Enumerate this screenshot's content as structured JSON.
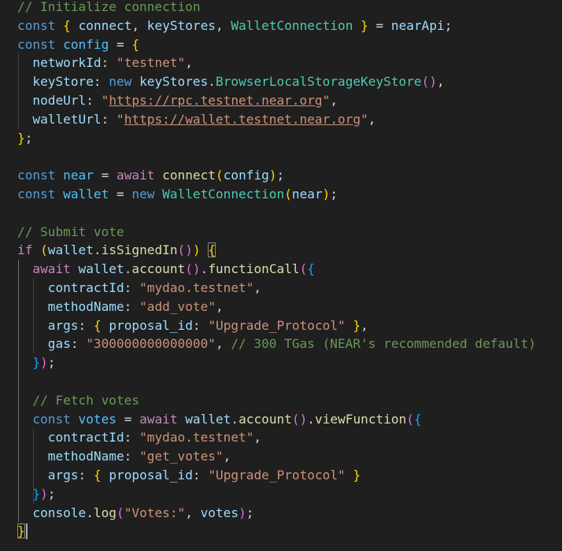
{
  "editor": {
    "language": "javascript",
    "theme_colors": {
      "background": "#1f1f1f",
      "keyword": "#569cd6",
      "control_keyword": "#c586c0",
      "variable": "#9cdcfe",
      "constant": "#4fc1ff",
      "class": "#4ec9b0",
      "function": "#dcdcaa",
      "string": "#ce9178",
      "comment": "#6a9955",
      "bracket_level_1": "#ffd700",
      "bracket_level_2": "#da70d6",
      "bracket_level_3": "#179fff"
    },
    "lines": [
      {
        "tokens": [
          {
            "t": "// Initialize connection",
            "c": "cm"
          }
        ]
      },
      {
        "tokens": [
          {
            "t": "const",
            "c": "kw"
          },
          {
            "t": " ",
            "c": "p"
          },
          {
            "t": "{",
            "c": "b1"
          },
          {
            "t": " ",
            "c": "p"
          },
          {
            "t": "connect",
            "c": "var"
          },
          {
            "t": ", ",
            "c": "p"
          },
          {
            "t": "keyStores",
            "c": "var"
          },
          {
            "t": ", ",
            "c": "p"
          },
          {
            "t": "WalletConnection",
            "c": "cls"
          },
          {
            "t": " ",
            "c": "p"
          },
          {
            "t": "}",
            "c": "b1"
          },
          {
            "t": " = ",
            "c": "p"
          },
          {
            "t": "nearApi",
            "c": "var"
          },
          {
            "t": ";",
            "c": "p"
          }
        ]
      },
      {
        "tokens": [
          {
            "t": "const",
            "c": "kw"
          },
          {
            "t": " ",
            "c": "p"
          },
          {
            "t": "config",
            "c": "const"
          },
          {
            "t": " = ",
            "c": "p"
          },
          {
            "t": "{",
            "c": "b1"
          }
        ]
      },
      {
        "tokens": [
          {
            "t": "  ",
            "c": "p"
          },
          {
            "t": "networkId",
            "c": "var"
          },
          {
            "t": ": ",
            "c": "p"
          },
          {
            "t": "\"testnet\"",
            "c": "str"
          },
          {
            "t": ",",
            "c": "p"
          }
        ]
      },
      {
        "tokens": [
          {
            "t": "  ",
            "c": "p"
          },
          {
            "t": "keyStore",
            "c": "var"
          },
          {
            "t": ": ",
            "c": "p"
          },
          {
            "t": "new",
            "c": "kw"
          },
          {
            "t": " ",
            "c": "p"
          },
          {
            "t": "keyStores",
            "c": "var"
          },
          {
            "t": ".",
            "c": "p"
          },
          {
            "t": "BrowserLocalStorageKeyStore",
            "c": "cls"
          },
          {
            "t": "()",
            "c": "b2"
          },
          {
            "t": ",",
            "c": "p"
          }
        ]
      },
      {
        "tokens": [
          {
            "t": "  ",
            "c": "p"
          },
          {
            "t": "nodeUrl",
            "c": "var"
          },
          {
            "t": ": ",
            "c": "p"
          },
          {
            "t": "\"",
            "c": "str"
          },
          {
            "t": "https://rpc.testnet.near.org",
            "c": "url"
          },
          {
            "t": "\"",
            "c": "str"
          },
          {
            "t": ",",
            "c": "p"
          }
        ]
      },
      {
        "tokens": [
          {
            "t": "  ",
            "c": "p"
          },
          {
            "t": "walletUrl",
            "c": "var"
          },
          {
            "t": ": ",
            "c": "p"
          },
          {
            "t": "\"",
            "c": "str"
          },
          {
            "t": "https://wallet.testnet.near.org",
            "c": "url"
          },
          {
            "t": "\"",
            "c": "str"
          },
          {
            "t": ",",
            "c": "p"
          }
        ]
      },
      {
        "tokens": [
          {
            "t": "}",
            "c": "b1"
          },
          {
            "t": ";",
            "c": "p"
          }
        ]
      },
      {
        "tokens": []
      },
      {
        "tokens": [
          {
            "t": "const",
            "c": "kw"
          },
          {
            "t": " ",
            "c": "p"
          },
          {
            "t": "near",
            "c": "const"
          },
          {
            "t": " = ",
            "c": "p"
          },
          {
            "t": "await",
            "c": "ctl"
          },
          {
            "t": " ",
            "c": "p"
          },
          {
            "t": "connect",
            "c": "fn"
          },
          {
            "t": "(",
            "c": "b1"
          },
          {
            "t": "config",
            "c": "var"
          },
          {
            "t": ")",
            "c": "b1"
          },
          {
            "t": ";",
            "c": "p"
          }
        ]
      },
      {
        "tokens": [
          {
            "t": "const",
            "c": "kw"
          },
          {
            "t": " ",
            "c": "p"
          },
          {
            "t": "wallet",
            "c": "const"
          },
          {
            "t": " = ",
            "c": "p"
          },
          {
            "t": "new",
            "c": "kw"
          },
          {
            "t": " ",
            "c": "p"
          },
          {
            "t": "WalletConnection",
            "c": "cls"
          },
          {
            "t": "(",
            "c": "b1"
          },
          {
            "t": "near",
            "c": "var"
          },
          {
            "t": ")",
            "c": "b1"
          },
          {
            "t": ";",
            "c": "p"
          }
        ]
      },
      {
        "tokens": []
      },
      {
        "tokens": [
          {
            "t": "// Submit vote",
            "c": "cm"
          }
        ]
      },
      {
        "tokens": [
          {
            "t": "if",
            "c": "ctl"
          },
          {
            "t": " ",
            "c": "p"
          },
          {
            "t": "(",
            "c": "b1"
          },
          {
            "t": "wallet",
            "c": "var"
          },
          {
            "t": ".",
            "c": "p"
          },
          {
            "t": "isSignedIn",
            "c": "fn"
          },
          {
            "t": "()",
            "c": "b2"
          },
          {
            "t": ")",
            "c": "b1"
          },
          {
            "t": " ",
            "c": "p"
          },
          {
            "t": "{",
            "c": "b1",
            "m": true
          }
        ]
      },
      {
        "tokens": [
          {
            "t": "  ",
            "c": "p"
          },
          {
            "t": "await",
            "c": "ctl"
          },
          {
            "t": " ",
            "c": "p"
          },
          {
            "t": "wallet",
            "c": "var"
          },
          {
            "t": ".",
            "c": "p"
          },
          {
            "t": "account",
            "c": "fn"
          },
          {
            "t": "()",
            "c": "b2"
          },
          {
            "t": ".",
            "c": "p"
          },
          {
            "t": "functionCall",
            "c": "fn"
          },
          {
            "t": "(",
            "c": "b2"
          },
          {
            "t": "{",
            "c": "b3"
          }
        ]
      },
      {
        "tokens": [
          {
            "t": "    ",
            "c": "p"
          },
          {
            "t": "contractId",
            "c": "var"
          },
          {
            "t": ": ",
            "c": "p"
          },
          {
            "t": "\"mydao.testnet\"",
            "c": "str"
          },
          {
            "t": ",",
            "c": "p"
          }
        ]
      },
      {
        "tokens": [
          {
            "t": "    ",
            "c": "p"
          },
          {
            "t": "methodName",
            "c": "var"
          },
          {
            "t": ": ",
            "c": "p"
          },
          {
            "t": "\"add_vote\"",
            "c": "str"
          },
          {
            "t": ",",
            "c": "p"
          }
        ]
      },
      {
        "tokens": [
          {
            "t": "    ",
            "c": "p"
          },
          {
            "t": "args",
            "c": "var"
          },
          {
            "t": ": ",
            "c": "p"
          },
          {
            "t": "{",
            "c": "b1"
          },
          {
            "t": " ",
            "c": "p"
          },
          {
            "t": "proposal_id",
            "c": "var"
          },
          {
            "t": ": ",
            "c": "p"
          },
          {
            "t": "\"Upgrade_Protocol\"",
            "c": "str"
          },
          {
            "t": " ",
            "c": "p"
          },
          {
            "t": "}",
            "c": "b1"
          },
          {
            "t": ",",
            "c": "p"
          }
        ]
      },
      {
        "tokens": [
          {
            "t": "    ",
            "c": "p"
          },
          {
            "t": "gas",
            "c": "var"
          },
          {
            "t": ": ",
            "c": "p"
          },
          {
            "t": "\"300000000000000\"",
            "c": "str"
          },
          {
            "t": ", ",
            "c": "p"
          },
          {
            "t": "// 300 TGas (NEAR's recommended default)",
            "c": "cm"
          }
        ]
      },
      {
        "tokens": [
          {
            "t": "  ",
            "c": "p"
          },
          {
            "t": "}",
            "c": "b3"
          },
          {
            "t": ")",
            "c": "b2"
          },
          {
            "t": ";",
            "c": "p"
          }
        ]
      },
      {
        "tokens": []
      },
      {
        "tokens": [
          {
            "t": "  ",
            "c": "p"
          },
          {
            "t": "// Fetch votes",
            "c": "cm"
          }
        ]
      },
      {
        "tokens": [
          {
            "t": "  ",
            "c": "p"
          },
          {
            "t": "const",
            "c": "kw"
          },
          {
            "t": " ",
            "c": "p"
          },
          {
            "t": "votes",
            "c": "const"
          },
          {
            "t": " = ",
            "c": "p"
          },
          {
            "t": "await",
            "c": "ctl"
          },
          {
            "t": " ",
            "c": "p"
          },
          {
            "t": "wallet",
            "c": "var"
          },
          {
            "t": ".",
            "c": "p"
          },
          {
            "t": "account",
            "c": "fn"
          },
          {
            "t": "()",
            "c": "b2"
          },
          {
            "t": ".",
            "c": "p"
          },
          {
            "t": "viewFunction",
            "c": "fn"
          },
          {
            "t": "(",
            "c": "b2"
          },
          {
            "t": "{",
            "c": "b3"
          }
        ]
      },
      {
        "tokens": [
          {
            "t": "    ",
            "c": "p"
          },
          {
            "t": "contractId",
            "c": "var"
          },
          {
            "t": ": ",
            "c": "p"
          },
          {
            "t": "\"mydao.testnet\"",
            "c": "str"
          },
          {
            "t": ",",
            "c": "p"
          }
        ]
      },
      {
        "tokens": [
          {
            "t": "    ",
            "c": "p"
          },
          {
            "t": "methodName",
            "c": "var"
          },
          {
            "t": ": ",
            "c": "p"
          },
          {
            "t": "\"get_votes\"",
            "c": "str"
          },
          {
            "t": ",",
            "c": "p"
          }
        ]
      },
      {
        "tokens": [
          {
            "t": "    ",
            "c": "p"
          },
          {
            "t": "args",
            "c": "var"
          },
          {
            "t": ": ",
            "c": "p"
          },
          {
            "t": "{",
            "c": "b1"
          },
          {
            "t": " ",
            "c": "p"
          },
          {
            "t": "proposal_id",
            "c": "var"
          },
          {
            "t": ": ",
            "c": "p"
          },
          {
            "t": "\"Upgrade_Protocol\"",
            "c": "str"
          },
          {
            "t": " ",
            "c": "p"
          },
          {
            "t": "}",
            "c": "b1"
          }
        ]
      },
      {
        "tokens": [
          {
            "t": "  ",
            "c": "p"
          },
          {
            "t": "}",
            "c": "b3"
          },
          {
            "t": ")",
            "c": "b2"
          },
          {
            "t": ";",
            "c": "p"
          }
        ]
      },
      {
        "tokens": [
          {
            "t": "  ",
            "c": "p"
          },
          {
            "t": "console",
            "c": "var"
          },
          {
            "t": ".",
            "c": "p"
          },
          {
            "t": "log",
            "c": "fn"
          },
          {
            "t": "(",
            "c": "b2"
          },
          {
            "t": "\"Votes:\"",
            "c": "str"
          },
          {
            "t": ", ",
            "c": "p"
          },
          {
            "t": "votes",
            "c": "var"
          },
          {
            "t": ")",
            "c": "b2"
          },
          {
            "t": ";",
            "c": "p"
          }
        ]
      },
      {
        "tokens": [
          {
            "t": "}",
            "c": "b1",
            "m": true
          }
        ]
      }
    ]
  }
}
